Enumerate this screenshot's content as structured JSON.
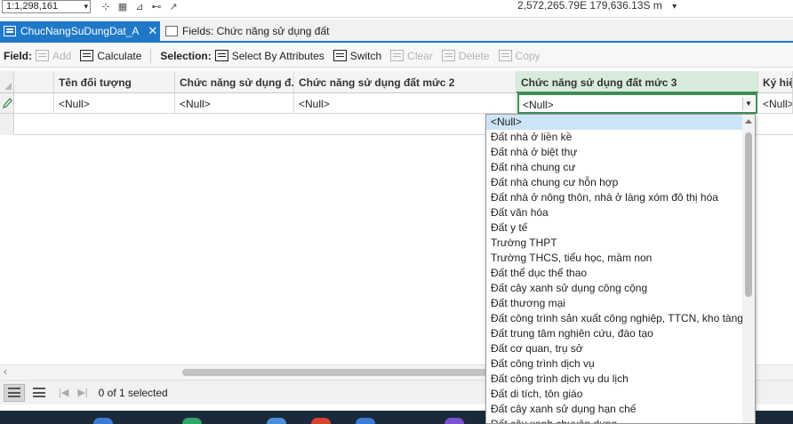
{
  "topbar": {
    "scale": "1:1,298,161",
    "coordinates": "2,572,265.79E 179,636.13S m"
  },
  "tabs": [
    {
      "label": "ChucNangSuDungDat_A"
    },
    {
      "label": "Fields: Chức năng sử dụng đất"
    }
  ],
  "toolbar": {
    "field_label": "Field:",
    "add_label": "Add",
    "calculate_label": "Calculate",
    "selection_label": "Selection:",
    "select_by_attributes_label": "Select By Attributes",
    "switch_label": "Switch",
    "clear_label": "Clear",
    "delete_label": "Delete",
    "copy_label": "Copy"
  },
  "table": {
    "columns": [
      "Tên đối tượng",
      "Chức năng sử dụng đ...",
      "Chức năng sử dụng đất mức 2",
      "Chức năng sử dụng đất mức 3",
      "Ký hiệu"
    ],
    "row": [
      "<Null>",
      "<Null>",
      "<Null>",
      "<Null>",
      "<Null>"
    ]
  },
  "dropdown": {
    "items": [
      "<Null>",
      "Đất nhà ở liền kề",
      "Đất nhà ở biệt thự",
      "Đất nhà chung cư",
      "Đất nhà chung cư hỗn hợp",
      "Đất nhà ở nông thôn, nhà ở làng xóm đô thị hóa",
      "Đất văn hóa",
      "Đất y tế",
      "Trường THPT",
      "Trường THCS, tiểu học, mầm non",
      "Đất thể dục thể thao",
      "Đất cây xanh sử dụng công cộng",
      "Đất thương mại",
      "Đất công trình sản xuất công nghiệp, TTCN, kho tàng",
      "Đất trung tâm nghiên cứu, đào tạo",
      "Đất cơ quan, trụ sở",
      "Đất công trình dịch vụ",
      "Đất công trình dịch vụ du lịch",
      "Đất di tích, tôn giáo",
      "Đất cây xanh sử dụng hạn chế",
      "Đất cây xanh chuyên dụng"
    ],
    "selected_index": 0
  },
  "statusbar": {
    "selection_text": "0 of 1 selected"
  },
  "colors": {
    "accent": "#1f78c8",
    "selected_column": "#3e8e56",
    "highlight": "#cce4f7"
  }
}
